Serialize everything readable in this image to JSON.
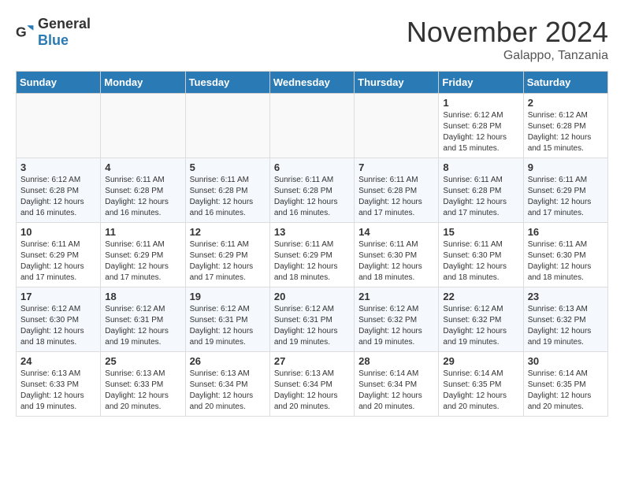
{
  "header": {
    "logo_general": "General",
    "logo_blue": "Blue",
    "month_title": "November 2024",
    "subtitle": "Galappo, Tanzania"
  },
  "calendar": {
    "days_of_week": [
      "Sunday",
      "Monday",
      "Tuesday",
      "Wednesday",
      "Thursday",
      "Friday",
      "Saturday"
    ],
    "weeks": [
      [
        {
          "day": "",
          "info": ""
        },
        {
          "day": "",
          "info": ""
        },
        {
          "day": "",
          "info": ""
        },
        {
          "day": "",
          "info": ""
        },
        {
          "day": "",
          "info": ""
        },
        {
          "day": "1",
          "info": "Sunrise: 6:12 AM\nSunset: 6:28 PM\nDaylight: 12 hours\nand 15 minutes."
        },
        {
          "day": "2",
          "info": "Sunrise: 6:12 AM\nSunset: 6:28 PM\nDaylight: 12 hours\nand 15 minutes."
        }
      ],
      [
        {
          "day": "3",
          "info": "Sunrise: 6:12 AM\nSunset: 6:28 PM\nDaylight: 12 hours\nand 16 minutes."
        },
        {
          "day": "4",
          "info": "Sunrise: 6:11 AM\nSunset: 6:28 PM\nDaylight: 12 hours\nand 16 minutes."
        },
        {
          "day": "5",
          "info": "Sunrise: 6:11 AM\nSunset: 6:28 PM\nDaylight: 12 hours\nand 16 minutes."
        },
        {
          "day": "6",
          "info": "Sunrise: 6:11 AM\nSunset: 6:28 PM\nDaylight: 12 hours\nand 16 minutes."
        },
        {
          "day": "7",
          "info": "Sunrise: 6:11 AM\nSunset: 6:28 PM\nDaylight: 12 hours\nand 17 minutes."
        },
        {
          "day": "8",
          "info": "Sunrise: 6:11 AM\nSunset: 6:28 PM\nDaylight: 12 hours\nand 17 minutes."
        },
        {
          "day": "9",
          "info": "Sunrise: 6:11 AM\nSunset: 6:29 PM\nDaylight: 12 hours\nand 17 minutes."
        }
      ],
      [
        {
          "day": "10",
          "info": "Sunrise: 6:11 AM\nSunset: 6:29 PM\nDaylight: 12 hours\nand 17 minutes."
        },
        {
          "day": "11",
          "info": "Sunrise: 6:11 AM\nSunset: 6:29 PM\nDaylight: 12 hours\nand 17 minutes."
        },
        {
          "day": "12",
          "info": "Sunrise: 6:11 AM\nSunset: 6:29 PM\nDaylight: 12 hours\nand 17 minutes."
        },
        {
          "day": "13",
          "info": "Sunrise: 6:11 AM\nSunset: 6:29 PM\nDaylight: 12 hours\nand 18 minutes."
        },
        {
          "day": "14",
          "info": "Sunrise: 6:11 AM\nSunset: 6:30 PM\nDaylight: 12 hours\nand 18 minutes."
        },
        {
          "day": "15",
          "info": "Sunrise: 6:11 AM\nSunset: 6:30 PM\nDaylight: 12 hours\nand 18 minutes."
        },
        {
          "day": "16",
          "info": "Sunrise: 6:11 AM\nSunset: 6:30 PM\nDaylight: 12 hours\nand 18 minutes."
        }
      ],
      [
        {
          "day": "17",
          "info": "Sunrise: 6:12 AM\nSunset: 6:30 PM\nDaylight: 12 hours\nand 18 minutes."
        },
        {
          "day": "18",
          "info": "Sunrise: 6:12 AM\nSunset: 6:31 PM\nDaylight: 12 hours\nand 19 minutes."
        },
        {
          "day": "19",
          "info": "Sunrise: 6:12 AM\nSunset: 6:31 PM\nDaylight: 12 hours\nand 19 minutes."
        },
        {
          "day": "20",
          "info": "Sunrise: 6:12 AM\nSunset: 6:31 PM\nDaylight: 12 hours\nand 19 minutes."
        },
        {
          "day": "21",
          "info": "Sunrise: 6:12 AM\nSunset: 6:32 PM\nDaylight: 12 hours\nand 19 minutes."
        },
        {
          "day": "22",
          "info": "Sunrise: 6:12 AM\nSunset: 6:32 PM\nDaylight: 12 hours\nand 19 minutes."
        },
        {
          "day": "23",
          "info": "Sunrise: 6:13 AM\nSunset: 6:32 PM\nDaylight: 12 hours\nand 19 minutes."
        }
      ],
      [
        {
          "day": "24",
          "info": "Sunrise: 6:13 AM\nSunset: 6:33 PM\nDaylight: 12 hours\nand 19 minutes."
        },
        {
          "day": "25",
          "info": "Sunrise: 6:13 AM\nSunset: 6:33 PM\nDaylight: 12 hours\nand 20 minutes."
        },
        {
          "day": "26",
          "info": "Sunrise: 6:13 AM\nSunset: 6:34 PM\nDaylight: 12 hours\nand 20 minutes."
        },
        {
          "day": "27",
          "info": "Sunrise: 6:13 AM\nSunset: 6:34 PM\nDaylight: 12 hours\nand 20 minutes."
        },
        {
          "day": "28",
          "info": "Sunrise: 6:14 AM\nSunset: 6:34 PM\nDaylight: 12 hours\nand 20 minutes."
        },
        {
          "day": "29",
          "info": "Sunrise: 6:14 AM\nSunset: 6:35 PM\nDaylight: 12 hours\nand 20 minutes."
        },
        {
          "day": "30",
          "info": "Sunrise: 6:14 AM\nSunset: 6:35 PM\nDaylight: 12 hours\nand 20 minutes."
        }
      ]
    ]
  }
}
